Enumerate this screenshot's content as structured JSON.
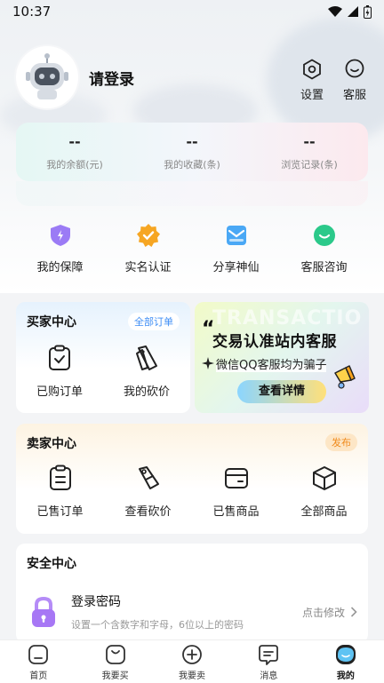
{
  "status_bar": {
    "time": "10:37"
  },
  "profile": {
    "login_label": "请登录"
  },
  "top_actions": [
    {
      "label": "设置",
      "icon": "settings-icon"
    },
    {
      "label": "客服",
      "icon": "support-icon"
    }
  ],
  "stats": [
    {
      "value": "--",
      "label": "我的余额(元)"
    },
    {
      "value": "--",
      "label": "我的收藏(条)"
    },
    {
      "value": "--",
      "label": "浏览记录(条)"
    }
  ],
  "quick_actions": [
    {
      "label": "我的保障",
      "icon": "shield-icon",
      "color": "#9b7bf5"
    },
    {
      "label": "实名认证",
      "icon": "verified-badge-icon",
      "color": "#f6a623"
    },
    {
      "label": "分享神仙",
      "icon": "share-mail-icon",
      "color": "#4aa8f5"
    },
    {
      "label": "客服咨询",
      "icon": "chat-bubble-icon",
      "color": "#2bc98a"
    }
  ],
  "buyer": {
    "title": "买家中心",
    "all_orders": "全部订单",
    "items": [
      {
        "label": "已购订单",
        "icon": "clipboard-check-icon"
      },
      {
        "label": "我的砍价",
        "icon": "price-tag-icon"
      }
    ]
  },
  "promo": {
    "watermark": "TRANSACTIO",
    "title": "交易认准站内客服",
    "subtitle": "微信QQ客服均为骗子",
    "button": "查看详情"
  },
  "seller": {
    "title": "卖家中心",
    "publish": "发布",
    "items": [
      {
        "label": "已售订单",
        "icon": "clipboard-list-icon"
      },
      {
        "label": "查看砍价",
        "icon": "price-tag-cut-icon"
      },
      {
        "label": "已售商品",
        "icon": "wallet-icon"
      },
      {
        "label": "全部商品",
        "icon": "box-icon"
      }
    ]
  },
  "security": {
    "title": "安全中心",
    "row_title": "登录密码",
    "row_desc": "设置一个含数字和字母，6位以上的密码",
    "row_link": "点击修改"
  },
  "tabs": [
    {
      "label": "首页",
      "icon": "home-icon"
    },
    {
      "label": "我要买",
      "icon": "shopping-bag-icon"
    },
    {
      "label": "我要卖",
      "icon": "plus-circle-icon"
    },
    {
      "label": "消息",
      "icon": "message-icon"
    },
    {
      "label": "我的",
      "icon": "profile-face-icon",
      "active": true
    }
  ],
  "colors": {
    "accent_blue": "#3f8ef5",
    "accent_orange": "#f08a1c",
    "page_bg": "#f3f4f6"
  }
}
